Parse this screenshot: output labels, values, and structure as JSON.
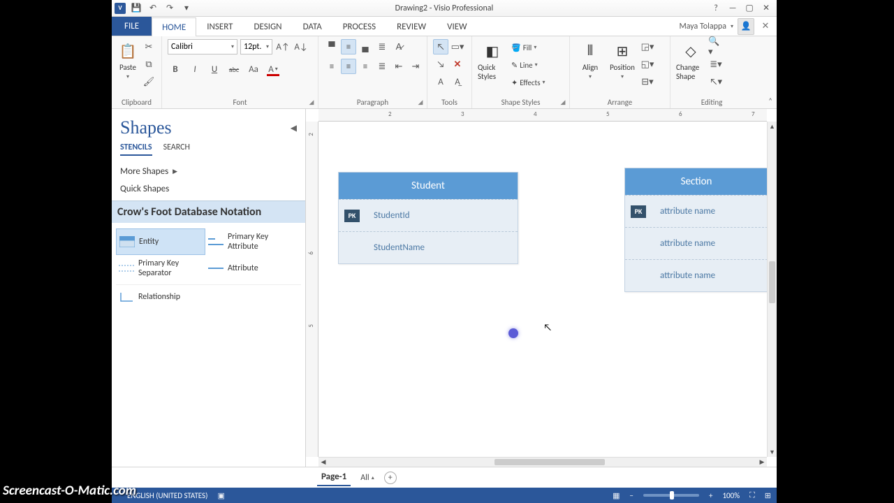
{
  "titlebar": {
    "title": "Drawing2 - Visio Professional"
  },
  "quick_access": {
    "save": "💾",
    "undo": "↶",
    "redo": "↷",
    "more": "▾"
  },
  "window_controls": {
    "help": "?",
    "min": "—",
    "max": "▢",
    "close": "✕"
  },
  "ribbon_tabs": {
    "file": "FILE",
    "items": [
      "HOME",
      "INSERT",
      "DESIGN",
      "DATA",
      "PROCESS",
      "REVIEW",
      "VIEW"
    ],
    "active_index": 0,
    "user_name": "Maya Tolappa"
  },
  "ribbon": {
    "clipboard": {
      "paste": "Paste",
      "label": "Clipboard"
    },
    "font": {
      "name": "Calibri",
      "size": "12pt.",
      "label": "Font",
      "bold": "B",
      "italic": "I",
      "underline": "U",
      "strike": "abc",
      "case": "Aa"
    },
    "paragraph": {
      "label": "Paragraph"
    },
    "tools": {
      "label": "Tools"
    },
    "shape_styles": {
      "quick": "Quick Styles",
      "fill": "Fill",
      "line": "Line",
      "effects": "Effects",
      "label": "Shape Styles"
    },
    "arrange": {
      "align": "Align",
      "position": "Position",
      "label": "Arrange"
    },
    "editing": {
      "change": "Change Shape",
      "label": "Editing"
    }
  },
  "shapes_panel": {
    "title": "Shapes",
    "tabs": {
      "stencils": "STENCILS",
      "search": "SEARCH"
    },
    "more": "More Shapes",
    "quick": "Quick Shapes",
    "stencil_name": "Crow's Foot Database Notation",
    "items": {
      "entity": "Entity",
      "pkattr": "Primary Key Attribute",
      "pksep": "Primary Key Separator",
      "attr": "Attribute",
      "rel": "Relationship"
    }
  },
  "canvas": {
    "ruler_h": [
      "2",
      "3",
      "4",
      "5",
      "6",
      "7"
    ],
    "ruler_v": [
      "2",
      "6",
      "5"
    ],
    "entity1": {
      "title": "Student",
      "pk": "PK",
      "r1": "StudentId",
      "r2": "StudentName"
    },
    "entity2": {
      "title": "Section",
      "pk": "PK",
      "r1": "attribute name",
      "r2": "attribute name",
      "r3": "attribute name"
    }
  },
  "pagetabs": {
    "page1": "Page-1",
    "all": "All",
    "add": "+"
  },
  "status": {
    "lang": "ENGLISH (UNITED STATES)",
    "zoom_pct": "100%",
    "zoom_minus": "−",
    "zoom_plus": "+"
  },
  "watermark": "Screencast-O-Matic.com"
}
